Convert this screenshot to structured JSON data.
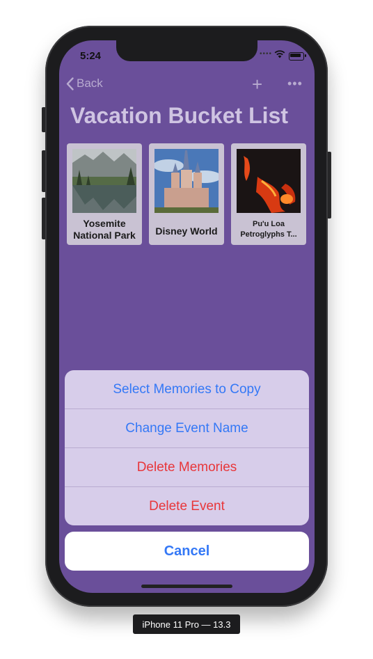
{
  "status_bar": {
    "time": "5:24"
  },
  "nav": {
    "back_label": "Back",
    "add_icon": "plus-icon",
    "more_icon": "ellipsis-icon"
  },
  "page": {
    "title": "Vacation Bucket List"
  },
  "cards": [
    {
      "caption": "Yosemite National Park",
      "image": "mountain-lake-photo"
    },
    {
      "caption": "Disney World",
      "image": "castle-photo"
    },
    {
      "caption": "Pu'u Loa Petroglyphs T...",
      "image": "lava-photo"
    }
  ],
  "action_sheet": {
    "items": [
      {
        "label": "Select Memories to Copy",
        "style": "default"
      },
      {
        "label": "Change Event Name",
        "style": "default"
      },
      {
        "label": "Delete Memories",
        "style": "destructive"
      },
      {
        "label": "Delete Event",
        "style": "destructive"
      }
    ],
    "cancel_label": "Cancel"
  },
  "device_label": "iPhone 11 Pro — 13.3",
  "colors": {
    "background": "#6a4f9a",
    "sheet": "#d7cdea",
    "action_blue": "#3478f6",
    "destructive_red": "#e8363a"
  }
}
